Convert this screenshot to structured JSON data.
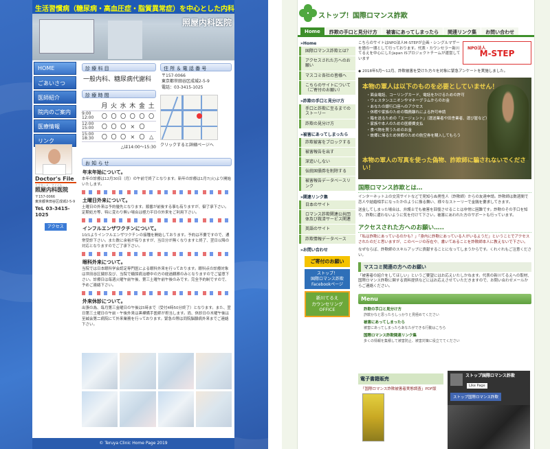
{
  "left": {
    "header": {
      "banner": "生活習慣病（糖尿病・高血圧症・脂質異常症）を中心とした内科専門診療所",
      "clinic_name": "照屋内科医院"
    },
    "nav": [
      {
        "label": "HOME",
        "active": true
      },
      {
        "label": "ごあいさつ"
      },
      {
        "label": "医師紹介"
      },
      {
        "label": "院内のご案内"
      },
      {
        "label": "医療情報"
      },
      {
        "label": "リンク"
      }
    ],
    "doctor": {
      "brand": "Doctor's File",
      "sub": "ドクターズ・ファイル"
    },
    "info": {
      "name": "照屋内科医院",
      "zip": "〒157-0066",
      "address": "東京都世田谷区成城2-5-9",
      "tel": "TeL 03-3415-1025",
      "access": "アクセス"
    },
    "subjects": {
      "head": "診 療 科 目",
      "value": "一般内科、糖尿病代謝科"
    },
    "hours": {
      "head": "診 療 時 間",
      "days": [
        "月",
        "火",
        "水",
        "木",
        "金",
        "土"
      ],
      "rows": [
        {
          "time": "9:00\n12:00",
          "marks": [
            "〇",
            "〇",
            "〇",
            "〇",
            "〇",
            "〇"
          ]
        },
        {
          "time": "12:00\n15:00",
          "marks": [
            "〇",
            "〇",
            "〇",
            "×",
            "〇",
            ""
          ]
        },
        {
          "time": "15:00\n18:30",
          "marks": [
            "〇",
            "〇",
            "〇",
            "×",
            "〇",
            "△"
          ]
        }
      ],
      "note": "△は14:00～15:30"
    },
    "address": {
      "head": "住 所 ＆ 電 話 番 号",
      "zip": "〒157-0066",
      "line": "東京都世田谷区成城2-5-9",
      "tel": "電話：03-3415-1025",
      "map_note": "クリックすると詳細ページへ"
    },
    "notice": {
      "head": "お 知 ら せ",
      "items": [
        {
          "title": "年末年始について。",
          "text": "本年の診療は12月30日（月）の午前で終了となります。新年の診療は1月7(火)より開始いたします。"
        },
        {
          "title": "土曜日外来について。",
          "text": "土曜日の外来は予約優先となります。順番が前後する事も有りますが、御了承下さい。定期処方等、特に変わり無い場合は極力平日の外来をご利用下さい。"
        },
        {
          "title": "インフルエンザワクチンについて。",
          "text": "10/1よりインフルエンザワクチンの接種を開始しております。予約は不要ですので、通常受診下さい。また数に余裕が有りますが、当日分が無くなりますと終了、翌日以降の対応となりますのでご了承下さい。"
        },
        {
          "title": "眼科外来について。",
          "text": "当院では日本眼科学会認定専門医による眼科外来を行っております。眼科点の診療対象は世田谷区健診及び、当院で糖尿病治療中の方の経過観察のみとなりますのでご留意下さい。診療日は毎週火曜午前午後、第三土曜午前午後のみです。完全予約制ですので、予めご連絡下さい。"
        },
        {
          "title": "外来休診について。",
          "text": "出張の為、毎月第三金曜日の午後は5時まで（受付4時50分終了）となります。また、翌日第三土曜日の午前・午後外来は黒樺備手医師が担当します。尚、休診日の木曜午後は至誠会第二病院にて外来業務を行っております。緊急の際は同院脳腺病外来までご連絡下さい。"
        }
      ]
    },
    "footer": "© Teruya Clinic Home Page 2019"
  },
  "right": {
    "header": {
      "title": "ストップ！国際ロマンス詐欺"
    },
    "nav": [
      {
        "label": "Home",
        "active": true
      },
      {
        "label": "詐欺の手口と見分け方"
      },
      {
        "label": "被害にあってしまったら"
      },
      {
        "label": "関連リンク集"
      },
      {
        "label": "お問い合わせ"
      }
    ],
    "sidebar": [
      {
        "head": "»Home",
        "items": [
          "国際ロマンス詐欺とは？",
          "アクセスされた方へのお願い",
          "マスコミ各社の皆様へ",
          "こちらのサイトについて（ご寄付のお願い）"
        ]
      },
      {
        "head": "»詐欺の手口と見分け方",
        "items": [
          "手口と詐欺に至るまでのストーリー",
          "詐欺の見分け方"
        ]
      },
      {
        "head": "»被害にあってしまったら",
        "items": [
          "詐欺被害をブロックする",
          "被害報告を出す",
          "深追いしない",
          "伝統国債券を削除する",
          "被害報告データベースリンク"
        ]
      },
      {
        "head": "»関連リンク集",
        "items": [
          "日本のサイト",
          "ロマンス詐欺関連公共団体及び救済サービス関連",
          "英語のサイト",
          "詐欺情報データベース"
        ]
      },
      {
        "head": "»お問い合わせ",
        "items": []
      }
    ],
    "donate": {
      "head": "ご寄付のお願い",
      "fb": "ストップ！\n国際ロマンス詐欺\nFacebookページ",
      "office": "新川てるえ\nカウンセリング\nOFFICE"
    },
    "intro": "こちらのサイトはNPO法人M-STEPが企画・シングルマザーを語の一環として行っております。代表・カウンセラー新川てるえを中心にしたJapan ISプロジェクトチームが運営しています",
    "mstep": {
      "npo": "NPO法人",
      "name": "M-STEP"
    },
    "announce": "◆ 2018年5月～12月、詐欺被害を受けた方々を対象に緊急アンケートを実施しました。",
    "hero": {
      "title": "本物の軍人は以下のものを必要としていません！",
      "items": [
        "・面会電話、コーリングカード、電話をかけるための許可",
        "・ウェスタンユニオンやマネーグラムからのお金",
        "・あなたの銀行口座へのアクセス",
        "・休暇や家族のための職務離れによる許可申請",
        "・箱を送るための「エージェント」（運送業者や田舎業者、運び屋など）",
        "・家族や本人のための医療費支払",
        "・食べ物を買うためのお金",
        "・故郷に帰るため休暇のための航空券を購入してもらう"
      ],
      "bottom": "本物の軍人の写真を使った偽物、詐欺師に騙されないでください！"
    },
    "sections": [
      {
        "title": "国際ロマンス詐欺とは…",
        "paras": [
          "インターネット上の交流サイトなどで見知らぬ男性人（詐欺師）からの友達申請。詐欺師は数週間で恋人や結婚相手になったかのように振る舞い、様々なストーリーで金銭を要求してきます。",
          "送金してしまった場合は、弁護士でも被害を回復させることは非常に困難です。詐欺のその手口を知り、詐欺に遭わないように気を付けて下さい。被害にあわれた方のサポートも行っています。"
        ]
      },
      {
        "title": "アクセスされた方へのお願い…..",
        "paras": [
          "「私は詐欺にあっているのかも？」「身内に詐欺にあっている人がいるようだ」ということでアクセスされたのだと思いますが、このページの存在や、書いてあることを詐欺師本人に教えないで下さい。",
          "なぜならば、詐欺師のスキルアップに貢献することになってしまうからです。くれぐれもご注意ください。"
        ]
      }
    ],
    "press": {
      "head": "マスコミ関連の方へのお願い",
      "text": "「被害者の紹介をしてほしい」というご要望にはお応えいたしかねます。代表の新川てるえへの取材、国際ロマンス詐欺に関する資料提供などにはお応えさせていただきますので、お問い合わせメールからご連絡ください。"
    },
    "menu": {
      "head": "Menu",
      "items": [
        {
          "title": "詐欺の手口と見分け方",
          "desc": "詐欺かなと思ったらしっかりと見極めてください"
        },
        {
          "title": "被害にあってしまったら",
          "desc": "被害にあってしまったらあなたができる行動はこちら"
        },
        {
          "title": "国際ロマンス詐欺関連リンク集",
          "desc": "多くの情報を集積して被害防止、被害対策に役立ててください"
        }
      ]
    },
    "book": {
      "head": "電子書籍販売",
      "title": "「国際ロマンス詐欺被害者実態調査」PDF版"
    },
    "fb_widget": {
      "title": "ストップ国際ロマンス詐欺",
      "sub": "2,000 likes",
      "button": "Like Page",
      "name": "ストップ国際ロマンス詐欺"
    }
  }
}
